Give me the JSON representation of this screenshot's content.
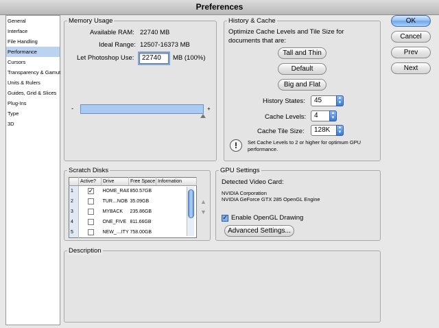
{
  "window": {
    "title": "Preferences"
  },
  "sidebar": {
    "items": [
      {
        "label": "General"
      },
      {
        "label": "Interface"
      },
      {
        "label": "File Handling"
      },
      {
        "label": "Performance",
        "selected": true
      },
      {
        "label": "Cursors"
      },
      {
        "label": "Transparency & Gamut"
      },
      {
        "label": "Units & Rulers"
      },
      {
        "label": "Guides, Grid & Slices"
      },
      {
        "label": "Plug-Ins"
      },
      {
        "label": "Type"
      },
      {
        "label": "3D"
      }
    ]
  },
  "memory": {
    "legend": "Memory Usage",
    "available_label": "Available RAM:",
    "available_value": "22740 MB",
    "ideal_label": "Ideal Range:",
    "ideal_value": "12507-16373 MB",
    "let_label": "Let Photoshop Use:",
    "let_value": "22740",
    "let_suffix": "MB (100%)",
    "slider_min": "-",
    "slider_max": "+",
    "slider_fraction": 1.0
  },
  "history": {
    "legend": "History & Cache",
    "desc": "Optimize Cache Levels and Tile Size for documents that are:",
    "btn_tall": "Tall and Thin",
    "btn_default": "Default",
    "btn_big": "Big and Flat",
    "states_label": "History States:",
    "states_value": "45",
    "levels_label": "Cache Levels:",
    "levels_value": "4",
    "tile_label": "Cache Tile Size:",
    "tile_value": "128K",
    "note": "Set Cache Levels to 2 or higher for optimum GPU performance.",
    "note_icon": "!"
  },
  "scratch": {
    "legend": "Scratch Disks",
    "columns": [
      "",
      "Active?",
      "Drive",
      "Free Space",
      "Information"
    ],
    "rows": [
      {
        "num": "1",
        "active": true,
        "drive": "HOME_RAID",
        "free": "850.57GB",
        "info": ""
      },
      {
        "num": "2",
        "active": false,
        "drive": "TUR…NOB",
        "free": "35.09GB",
        "info": ""
      },
      {
        "num": "3",
        "active": false,
        "drive": "MYBACK",
        "free": "235.86GB",
        "info": ""
      },
      {
        "num": "4",
        "active": false,
        "drive": "ONE_FIVE",
        "free": "811.66GB",
        "info": ""
      },
      {
        "num": "5",
        "active": false,
        "drive": "NEW_…ITY",
        "free": "758.00GB",
        "info": ""
      }
    ]
  },
  "gpu": {
    "legend": "GPU Settings",
    "detected_label": "Detected Video Card:",
    "vendor": "NVIDIA Corporation",
    "card": "NVIDIA GeForce GTX 285 OpenGL Engine",
    "opengl_label": "Enable OpenGL Drawing",
    "opengl_checked": true,
    "advanced_label": "Advanced Settings..."
  },
  "description": {
    "legend": "Description"
  },
  "actions": {
    "ok": "OK",
    "cancel": "Cancel",
    "prev": "Prev",
    "next": "Next"
  }
}
